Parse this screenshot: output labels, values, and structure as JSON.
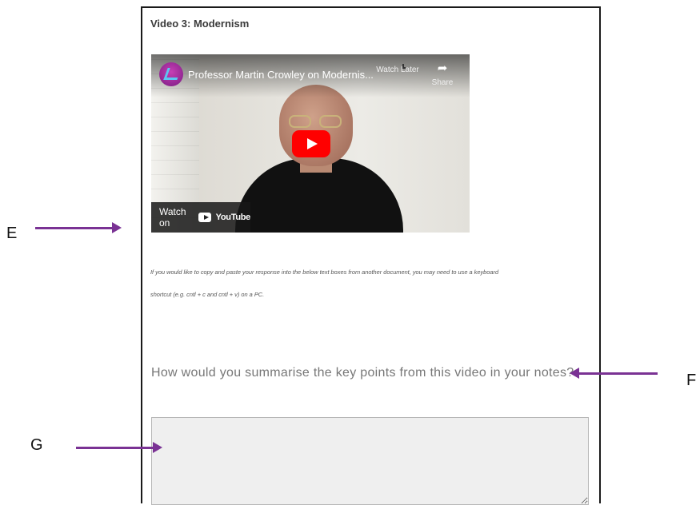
{
  "page": {
    "video_section_title": "Video 3: Modernism",
    "paste_note_line1": "If you would like to copy and paste your response into the below text boxes from another document, you may need to use a keyboard",
    "paste_note_line2": "shortcut (e.g. cntl + c and cntl + v) on a PC.",
    "question": "How would you summarise the key points from this video in your notes?",
    "answer_value": ""
  },
  "video": {
    "title": "Professor Martin Crowley on Modernis...",
    "actions": [
      {
        "label": "Watch Later",
        "icon": "clock-icon"
      },
      {
        "label": "Share",
        "icon": "share-icon"
      }
    ],
    "watch_on_label": "Watch on",
    "platform": "YouTube"
  },
  "annotations": {
    "e": "E",
    "f": "F",
    "g": "G",
    "arrow_color": "#7a3294"
  },
  "colors": {
    "play_button": "#ff0000",
    "frame_border": "#1a1a1a",
    "answer_box_bg": "#efefef"
  }
}
